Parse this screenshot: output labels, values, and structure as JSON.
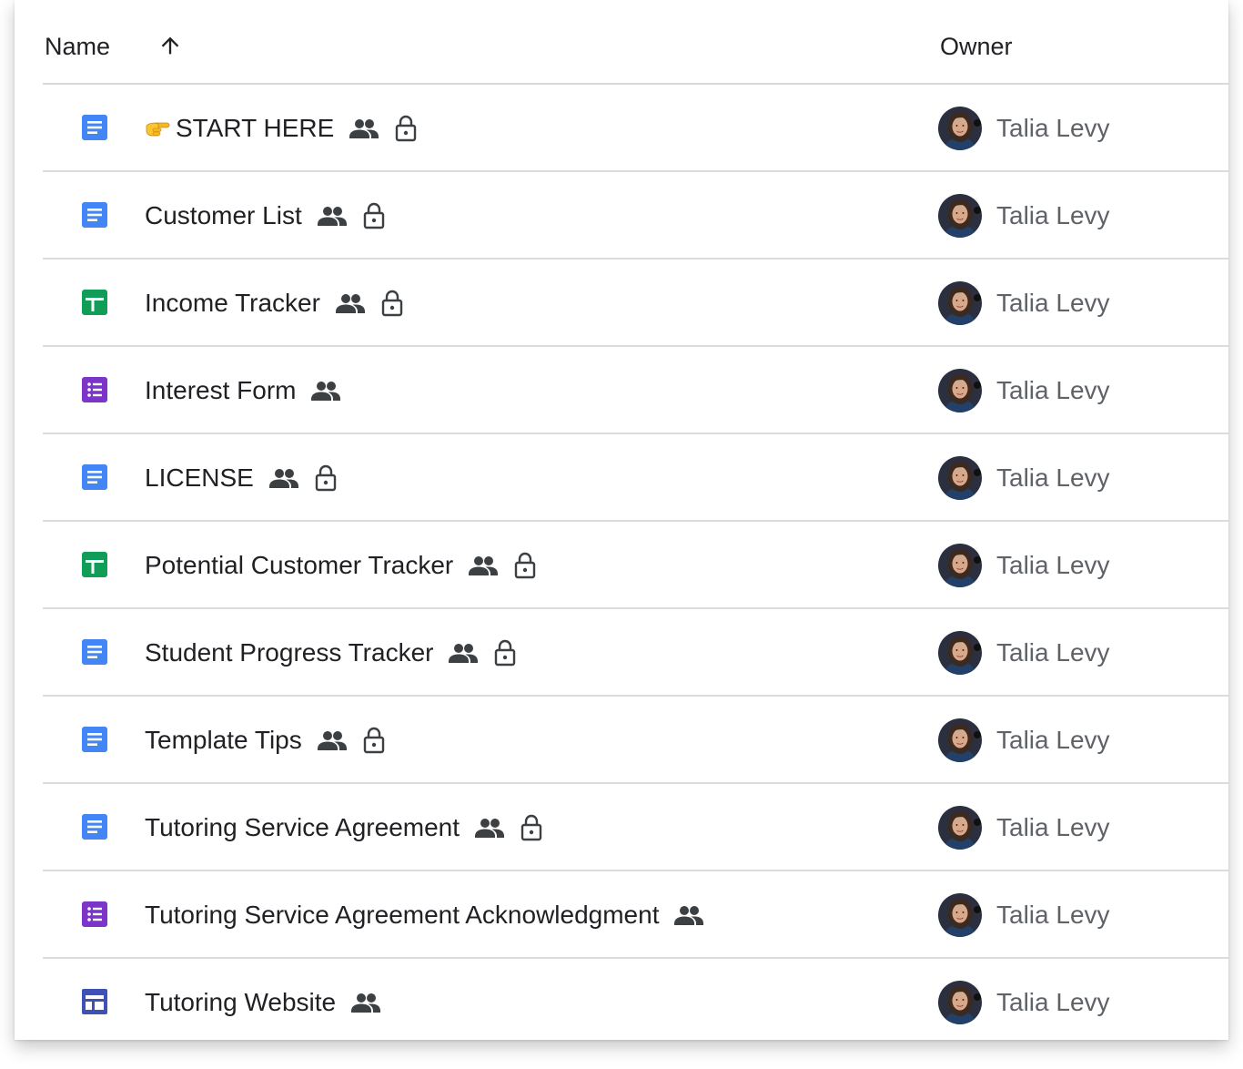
{
  "header": {
    "name_label": "Name",
    "sort_icon": "arrow-upward-icon",
    "owner_label": "Owner"
  },
  "colors": {
    "docs": "#4285f4",
    "sheets": "#0f9d58",
    "forms": "#7b35c9",
    "sites": "#3f51b5",
    "icon_gray": "#3c4043"
  },
  "files": [
    {
      "name": "START HERE",
      "prefix_emoji": "backhand-index-pointing-right",
      "type": "docs",
      "shared": true,
      "locked": true,
      "owner": "Talia Levy"
    },
    {
      "name": "Customer List",
      "type": "docs",
      "shared": true,
      "locked": true,
      "owner": "Talia Levy"
    },
    {
      "name": "Income Tracker",
      "type": "sheets",
      "shared": true,
      "locked": true,
      "owner": "Talia Levy"
    },
    {
      "name": "Interest Form",
      "type": "forms",
      "shared": true,
      "locked": false,
      "owner": "Talia Levy"
    },
    {
      "name": "LICENSE",
      "type": "docs",
      "shared": true,
      "locked": true,
      "owner": "Talia Levy"
    },
    {
      "name": "Potential Customer Tracker",
      "type": "sheets",
      "shared": true,
      "locked": true,
      "owner": "Talia Levy"
    },
    {
      "name": "Student Progress Tracker",
      "type": "docs",
      "shared": true,
      "locked": true,
      "owner": "Talia Levy"
    },
    {
      "name": "Template Tips",
      "type": "docs",
      "shared": true,
      "locked": true,
      "owner": "Talia Levy"
    },
    {
      "name": "Tutoring Service Agreement",
      "type": "docs",
      "shared": true,
      "locked": true,
      "owner": "Talia Levy"
    },
    {
      "name": "Tutoring Service Agreement Acknowledgment",
      "type": "forms",
      "shared": true,
      "locked": false,
      "owner": "Talia Levy"
    },
    {
      "name": "Tutoring Website",
      "type": "sites",
      "shared": true,
      "locked": false,
      "owner": "Talia Levy"
    }
  ]
}
